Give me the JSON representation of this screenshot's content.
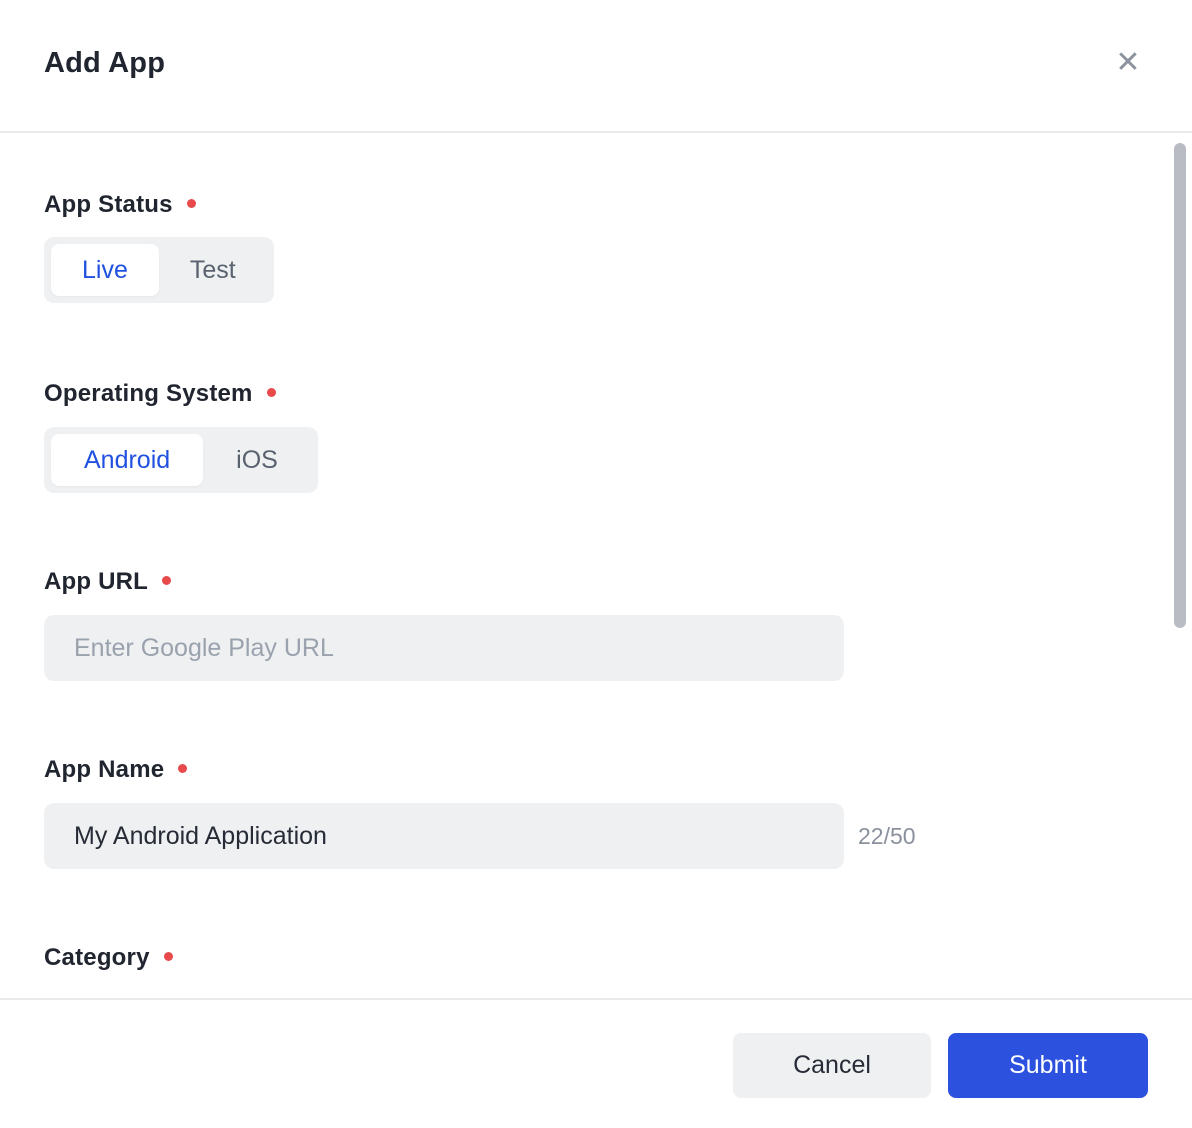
{
  "modal": {
    "title": "Add App",
    "close_icon": "✕"
  },
  "fields": {
    "app_status": {
      "label": "App Status",
      "required": true,
      "options": [
        {
          "label": "Live",
          "selected": true
        },
        {
          "label": "Test",
          "selected": false
        }
      ]
    },
    "operating_system": {
      "label": "Operating System",
      "required": true,
      "options": [
        {
          "label": "Android",
          "selected": true
        },
        {
          "label": "iOS",
          "selected": false
        }
      ]
    },
    "app_url": {
      "label": "App URL",
      "required": true,
      "placeholder": "Enter Google Play URL",
      "value": ""
    },
    "app_name": {
      "label": "App Name",
      "required": true,
      "value": "My Android Application",
      "counter": "22/50"
    },
    "category": {
      "label": "Category",
      "required": true
    }
  },
  "footer": {
    "cancel_label": "Cancel",
    "submit_label": "Submit"
  },
  "colors": {
    "accent_blue": "#2b51de",
    "accent_blue_text": "#2151e0",
    "required_red": "#e8494b",
    "field_bg": "#eef0f2",
    "label_dark": "#20252f",
    "input_text": "#262b36",
    "muted_text": "#5a6270",
    "placeholder": "#9aa2ad",
    "counter": "#8a919d",
    "close_gray": "#8d939e",
    "divider": "#e9eaec",
    "scrollbar_thumb": "#b9bdc3"
  }
}
